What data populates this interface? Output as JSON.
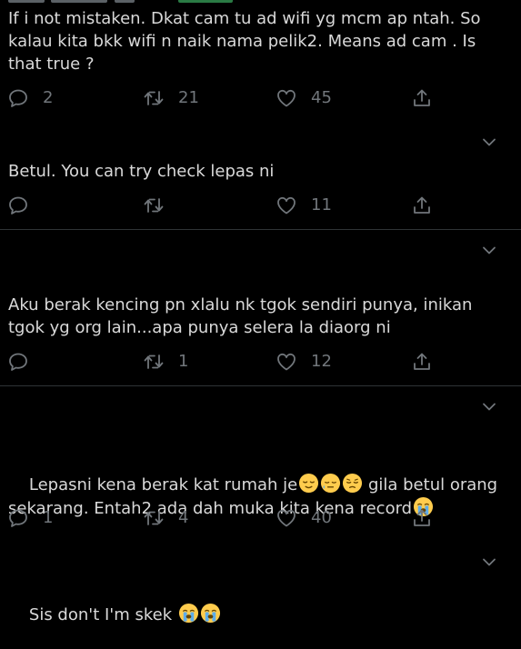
{
  "tweets": [
    {
      "text": "If i not mistaken. Dkat cam tu ad wifi yg mcm ap ntah. So kalau kita bkk wifi n naik nama pelik2. Means ad cam . Is that true ?",
      "replies": "2",
      "retweets": "21",
      "likes": "45"
    },
    {
      "text": "Betul. You can try check lepas ni",
      "replies": "",
      "retweets": "",
      "likes": "11"
    },
    {
      "text": "Aku berak kencing pn xlalu nk tgok sendiri punya, inikan tgok yg org lain...apa punya selera la diaorg ni",
      "replies": "",
      "retweets": "1",
      "likes": "12"
    },
    {
      "text_line1_prefix": "Lepasni kena berak kat rumah je",
      "text_line1_suffix": " gila betul orang",
      "text_line2": "sekarang. Entah2 ada dah muka kita kena record",
      "replies": "1",
      "retweets": "4",
      "likes": "40"
    },
    {
      "text": "Sis don't I'm skek "
    }
  ],
  "icons": {
    "reply": "reply-icon",
    "retweet": "retweet-icon",
    "like": "heart-icon",
    "share": "share-icon",
    "more": "chevron-down-icon"
  },
  "colors": {
    "background": "#000000",
    "text": "#d9d9d9",
    "muted": "#71767b",
    "divider": "#2f3336"
  }
}
